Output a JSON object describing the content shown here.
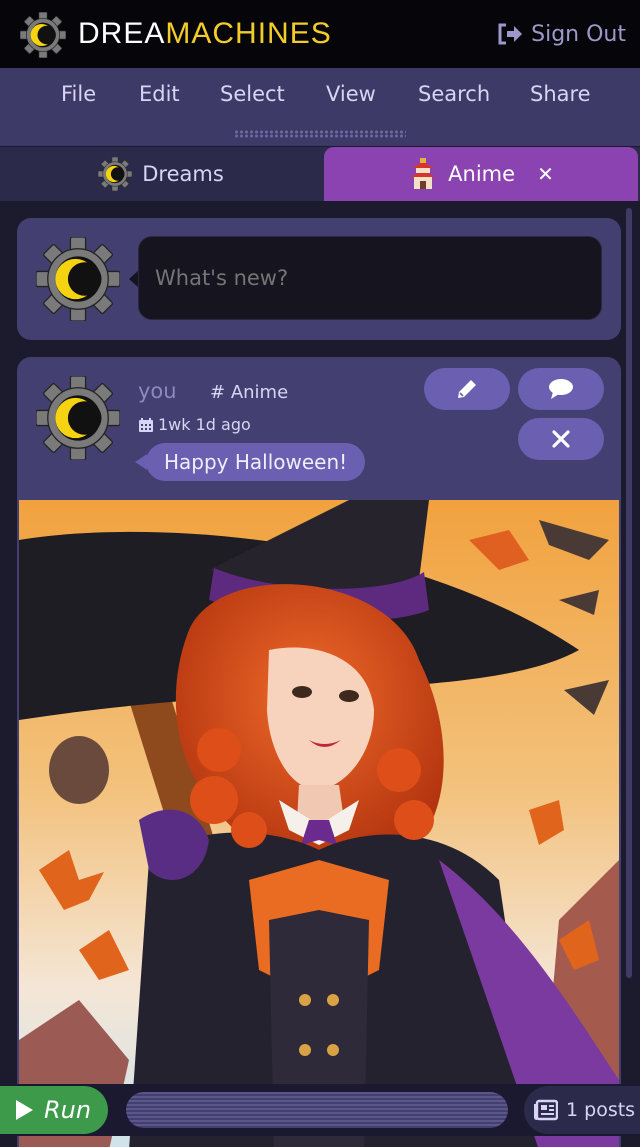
{
  "header": {
    "brand_part1": "DREA",
    "brand_part2": "MACHINES",
    "signout_label": "Sign Out",
    "brand_color": "#f2cc2a"
  },
  "menu": {
    "items": [
      "File",
      "Edit",
      "Select",
      "View",
      "Search",
      "Share"
    ]
  },
  "tabs": [
    {
      "label": "Dreams",
      "icon": "moon-gear-icon",
      "active": false
    },
    {
      "label": "Anime",
      "icon": "pagoda-icon",
      "active": true,
      "close": "✕"
    }
  ],
  "compose": {
    "placeholder": "What's new?"
  },
  "post": {
    "user": "you",
    "tag": "Anime",
    "time": "1wk 1d ago",
    "message": "Happy Halloween!",
    "buttons": [
      "pencil-icon",
      "comment-icon",
      "close-icon"
    ],
    "image_subject": "anime witch with red curly hair, purple hat, broom, bats and autumn leaves"
  },
  "bottom": {
    "run_label": "Run",
    "posts_count": "1 posts"
  },
  "colors": {
    "accent_purple": "#8c43b2",
    "panel": "#433f70",
    "run_green": "#3c9a4a"
  }
}
